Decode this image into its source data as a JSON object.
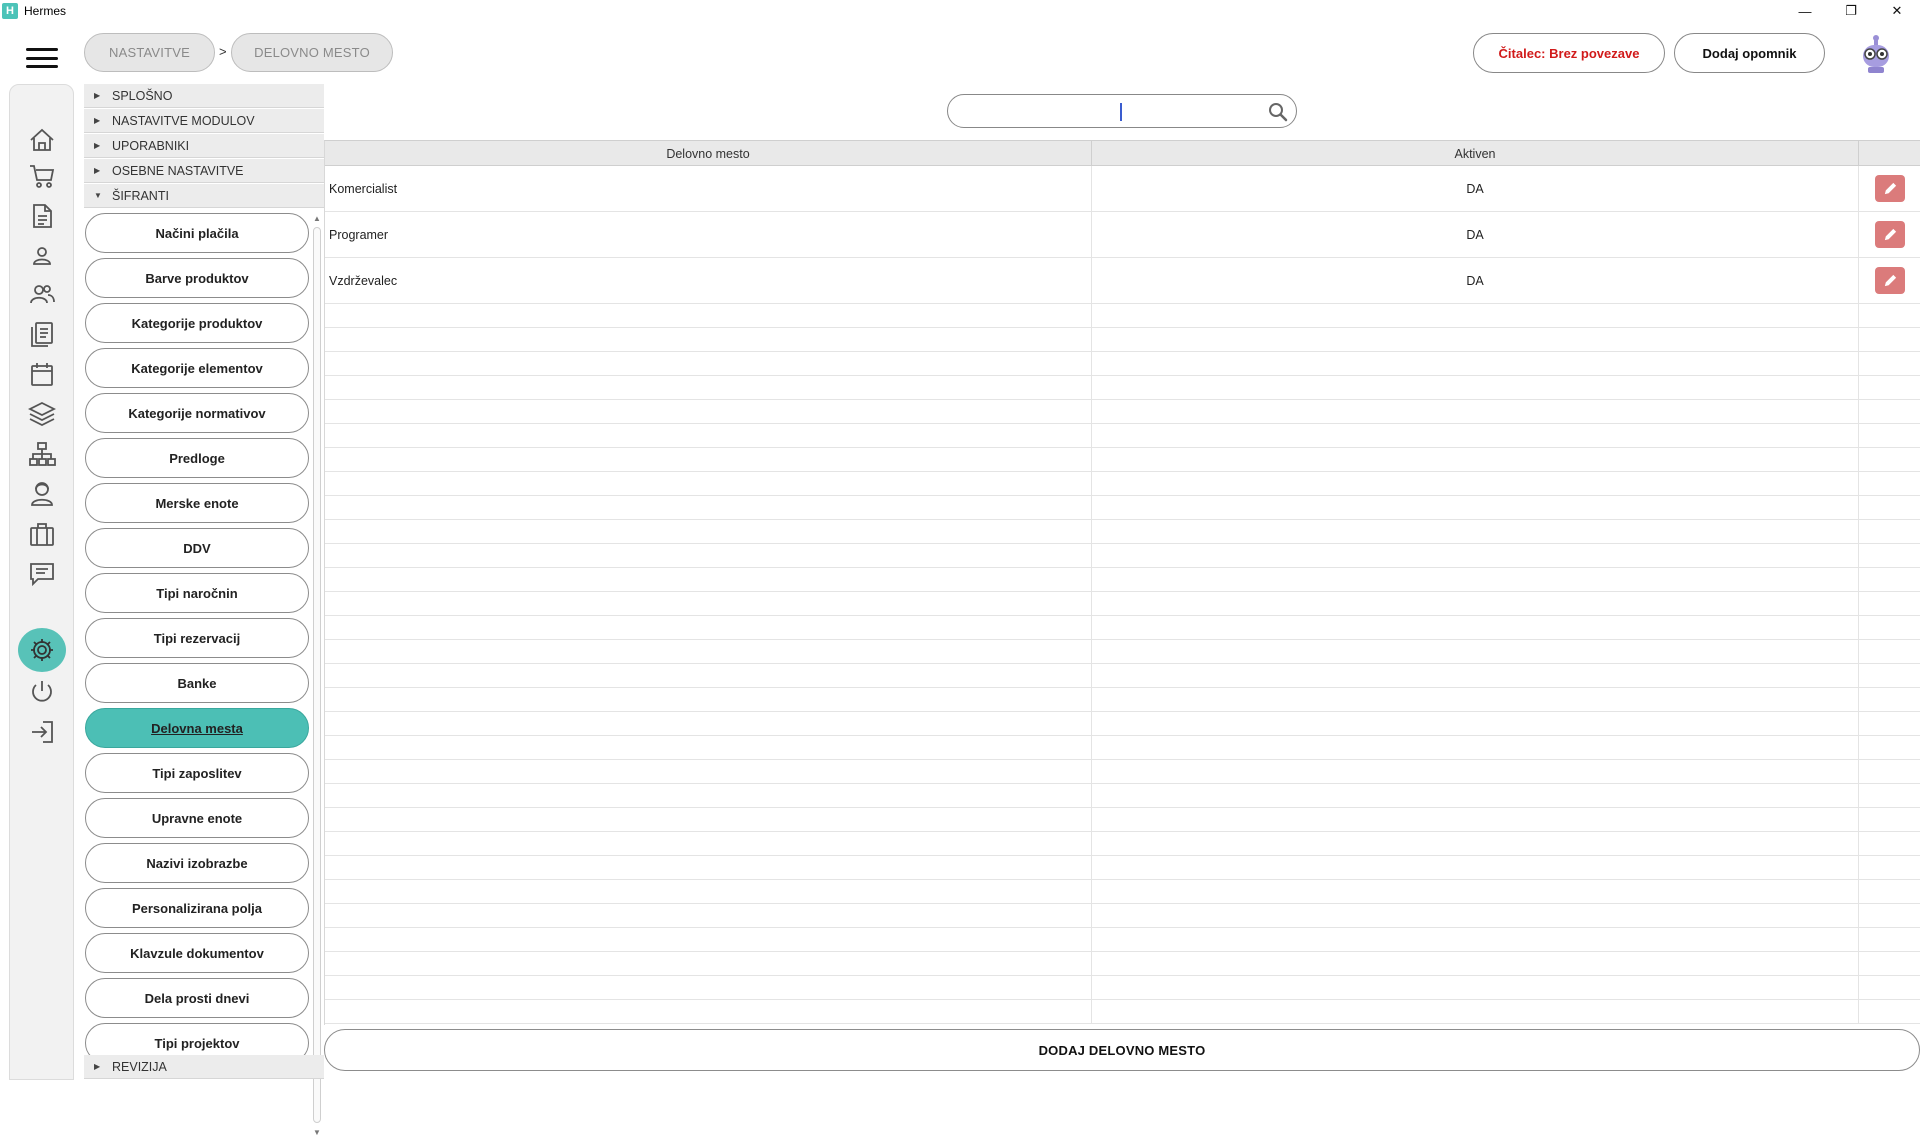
{
  "window": {
    "title": "Hermes",
    "app_icon_glyph": "H"
  },
  "window_controls": {
    "minimize": "—",
    "restore": "❐",
    "close": "✕"
  },
  "breadcrumb": {
    "items": [
      "NASTAVITVE",
      "DELOVNO MESTO"
    ],
    "separator": ">"
  },
  "header": {
    "reader_status": "Čitalec: Brez povezave",
    "add_reminder": "Dodaj opomnik"
  },
  "colors": {
    "accent": "#4cbfb5",
    "danger_text": "#d11a1a",
    "edit_button": "#db7b7b"
  },
  "sidebar_icons": [
    "home-icon",
    "cart-icon",
    "document-icon",
    "person-icon",
    "people-icon",
    "reports-icon",
    "calendar-icon",
    "layers-icon",
    "network-icon",
    "support-icon",
    "briefcase-icon",
    "chat-icon",
    "gear-icon",
    "power-icon",
    "logout-icon"
  ],
  "nav": {
    "sections": [
      "SPLOŠNO",
      "NASTAVITVE MODULOV",
      "UPORABNIKI",
      "OSEBNE NASTAVITVE",
      "ŠIFRANTI"
    ],
    "open_section": "ŠIFRANTI",
    "footer_section": "REVIZIJA",
    "items": [
      "Načini plačila",
      "Barve produktov",
      "Kategorije produktov",
      "Kategorije elementov",
      "Kategorije normativov",
      "Predloge",
      "Merske enote",
      "DDV",
      "Tipi naročnin",
      "Tipi rezervacij",
      "Banke",
      "Delovna mesta",
      "Tipi zaposlitev",
      "Upravne enote",
      "Nazivi izobrazbe",
      "Personalizirana polja",
      "Klavzule dokumentov",
      "Dela prosti dnevi",
      "Tipi projektov"
    ],
    "active_item": "Delovna mesta"
  },
  "search": {
    "value": "",
    "placeholder": ""
  },
  "table": {
    "columns": [
      "Delovno mesto",
      "Aktiven",
      ""
    ],
    "rows": [
      {
        "name": "Komercialist",
        "active": "DA"
      },
      {
        "name": "Programer",
        "active": "DA"
      },
      {
        "name": "Vzdrževalec",
        "active": "DA"
      }
    ]
  },
  "footer": {
    "add_button": "DODAJ DELOVNO MESTO"
  }
}
